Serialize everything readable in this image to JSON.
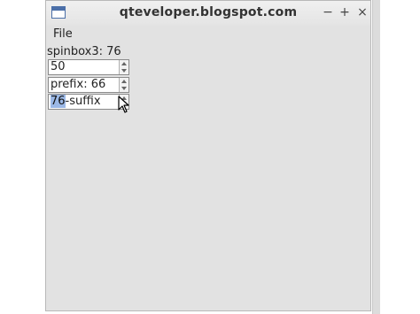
{
  "window": {
    "title": "qteveloper.blogspot.com",
    "controls": {
      "minimize": "−",
      "maximize": "+",
      "close": "×"
    }
  },
  "menu": {
    "file": "File"
  },
  "label": "spinbox3: 76",
  "spinboxes": [
    {
      "value": "50"
    },
    {
      "value": "prefix: 66"
    },
    {
      "selected": "76",
      "rest": "-suffix"
    }
  ]
}
